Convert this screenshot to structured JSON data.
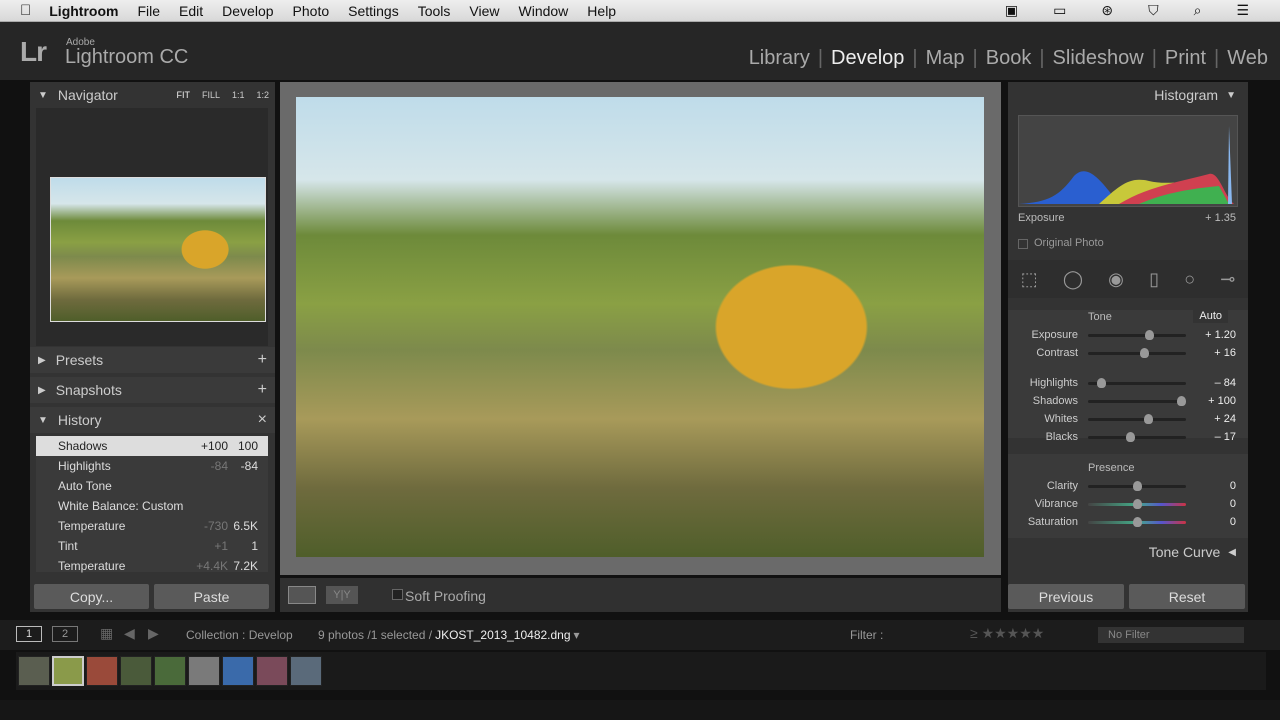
{
  "menubar": {
    "app": "Lightroom",
    "items": [
      "File",
      "Edit",
      "Develop",
      "Photo",
      "Settings",
      "Tools",
      "View",
      "Window",
      "Help"
    ]
  },
  "logo": {
    "mark": "Lr",
    "adobe": "Adobe",
    "name": "Lightroom CC"
  },
  "modules": [
    {
      "label": "Library",
      "active": false
    },
    {
      "label": "Develop",
      "active": true
    },
    {
      "label": "Map",
      "active": false
    },
    {
      "label": "Book",
      "active": false
    },
    {
      "label": "Slideshow",
      "active": false
    },
    {
      "label": "Print",
      "active": false
    },
    {
      "label": "Web",
      "active": false
    }
  ],
  "left": {
    "navigator": {
      "title": "Navigator",
      "zoom_options": [
        "FIT",
        "FILL",
        "1:1",
        "1:2"
      ]
    },
    "presets": "Presets",
    "snapshots": "Snapshots",
    "history_title": "History",
    "history": [
      {
        "name": "Shadows",
        "delta": "+100",
        "value": "100",
        "selected": true
      },
      {
        "name": "Highlights",
        "delta": "-84",
        "value": "-84"
      },
      {
        "name": "Auto Tone",
        "delta": "",
        "value": ""
      },
      {
        "name": "White Balance: Custom",
        "delta": "",
        "value": ""
      },
      {
        "name": "Temperature",
        "delta": "-730",
        "value": "6.5K"
      },
      {
        "name": "Tint",
        "delta": "+1",
        "value": "1"
      },
      {
        "name": "Temperature",
        "delta": "+4.4K",
        "value": "7.2K"
      }
    ],
    "copy": "Copy...",
    "paste": "Paste"
  },
  "toolbar": {
    "soft_proofing": "Soft Proofing"
  },
  "right": {
    "histogram": "Histogram",
    "hist_label": "Exposure",
    "hist_value": "+ 1.35",
    "original_photo": "Original Photo",
    "tone": "Tone",
    "auto": "Auto",
    "sliders": [
      {
        "label": "Exposure",
        "value": "+ 1.20",
        "pos": 0.62
      },
      {
        "label": "Contrast",
        "value": "+ 16",
        "pos": 0.57
      },
      {
        "label": "Highlights",
        "value": "– 84",
        "pos": 0.13
      },
      {
        "label": "Shadows",
        "value": "+ 100",
        "pos": 0.95
      },
      {
        "label": "Whites",
        "value": "+ 24",
        "pos": 0.61
      },
      {
        "label": "Blacks",
        "value": "– 17",
        "pos": 0.43
      }
    ],
    "presence": "Presence",
    "presence_sliders": [
      {
        "label": "Clarity",
        "value": "0",
        "pos": 0.5
      },
      {
        "label": "Vibrance",
        "value": "0",
        "pos": 0.5
      },
      {
        "label": "Saturation",
        "value": "0",
        "pos": 0.5
      }
    ],
    "tone_curve": "Tone Curve",
    "previous": "Previous",
    "reset": "Reset"
  },
  "filmstrip": {
    "screen1": "1",
    "screen2": "2",
    "source": "Collection : Develop",
    "count": "9 photos /1 selected /",
    "filename": "JKOST_2013_10482.dng",
    "filter_label": "Filter :",
    "filter_value": "No Filter",
    "rating": "≥ ★★★★★",
    "thumb_colors": [
      "#5a5e50",
      "#8a9a4a",
      "#9a4a3a",
      "#4a5a3a",
      "#4a6a3a",
      "#7a7a7a",
      "#3a6aaa",
      "#7a4a5a",
      "#5a6a7a"
    ]
  }
}
